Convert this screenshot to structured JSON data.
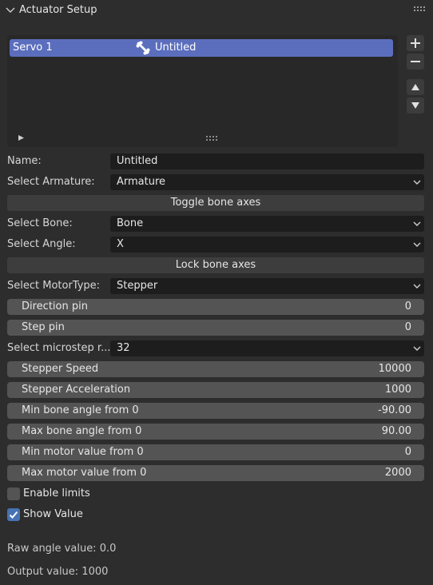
{
  "panel": {
    "title": "Actuator Setup"
  },
  "list": {
    "items": [
      {
        "name": "Servo 1",
        "bone_label": "Untitled"
      }
    ]
  },
  "form": {
    "name_label": "Name:",
    "name_value": "Untitled",
    "armature_label": "Select Armature:",
    "armature_value": "Armature",
    "toggle_bone_axes": "Toggle bone axes",
    "bone_label": "Select Bone:",
    "bone_value": "Bone",
    "angle_label": "Select Angle:",
    "angle_value": "X",
    "lock_bone_axes": "Lock bone axes",
    "motortype_label": "Select MotorType:",
    "motortype_value": "Stepper",
    "direction_pin": {
      "label": "Direction pin",
      "value": "0"
    },
    "step_pin": {
      "label": "Step pin",
      "value": "0"
    },
    "microstep_label": "Select microstep r...",
    "microstep_value": "32",
    "stepper_speed": {
      "label": "Stepper Speed",
      "value": "10000"
    },
    "stepper_accel": {
      "label": "Stepper Acceleration",
      "value": "1000"
    },
    "min_bone_angle": {
      "label": "Min bone angle from 0",
      "value": "-90.00"
    },
    "max_bone_angle": {
      "label": "Max bone angle from 0",
      "value": "90.00"
    },
    "min_motor_value": {
      "label": "Min motor value from 0",
      "value": "0"
    },
    "max_motor_value": {
      "label": "Max motor value from 0",
      "value": "2000"
    },
    "enable_limits": {
      "label": "Enable limits",
      "checked": false
    },
    "show_value": {
      "label": "Show Value",
      "checked": true
    }
  },
  "info": {
    "raw_angle": "Raw angle value: 0.0",
    "output_value": "Output value: 1000"
  },
  "colors": {
    "accent": "#4772b3",
    "list_highlight": "#5b6ebd",
    "background": "#2d2d2d"
  }
}
